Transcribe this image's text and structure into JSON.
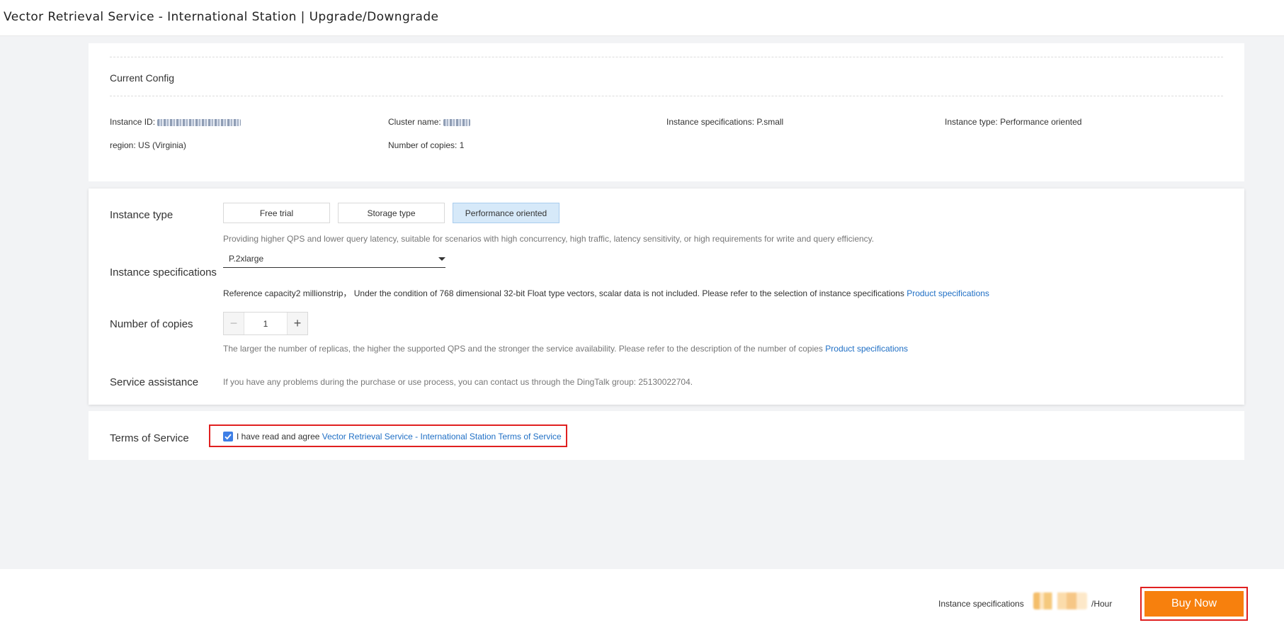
{
  "page": {
    "title": "Vector Retrieval Service - International Station | Upgrade/Downgrade"
  },
  "current_config": {
    "title": "Current Config",
    "instance_id_label": "Instance ID:",
    "cluster_name_label": "Cluster name:",
    "instance_spec_label": "Instance specifications:",
    "instance_spec_value": "P.small",
    "instance_type_label": "Instance type:",
    "instance_type_value": "Performance oriented",
    "region_label": "region:",
    "region_value": "US (Virginia)",
    "copies_label": "Number of copies:",
    "copies_value": "1"
  },
  "config": {
    "instance_type": {
      "label": "Instance type",
      "options": [
        "Free trial",
        "Storage type",
        "Performance oriented"
      ],
      "selected": "Performance oriented",
      "hint": "Providing higher QPS and lower query latency, suitable for scenarios with high concurrency, high traffic, latency sensitivity, or high requirements for write and query efficiency."
    },
    "instance_spec": {
      "label": "Instance specifications",
      "value": "P.2xlarge",
      "hint": "Reference capacity2 millionstrip， Under the condition of 768 dimensional 32-bit Float type vectors, scalar data is not included. Please refer to the selection of instance specifications",
      "link": "Product specifications"
    },
    "copies": {
      "label": "Number of copies",
      "minus": "−",
      "plus": "+",
      "value": "1",
      "hint": "The larger the number of replicas, the higher the supported QPS and the stronger the service availability. Please refer to the description of the number of copies",
      "link": "Product specifications"
    },
    "assistance": {
      "label": "Service assistance",
      "text": "If you have any problems during the purchase or use process, you can contact us through the DingTalk group: 25130022704."
    }
  },
  "terms": {
    "label": "Terms of Service",
    "checked": true,
    "agree_text": "I have read and agree",
    "link": "Vector Retrieval Service - International Station Terms of Service"
  },
  "footer": {
    "price_label": "Instance specifications",
    "price_unit": "/Hour",
    "buy_label": "Buy Now"
  },
  "colors": {
    "accent": "#f7800d",
    "link": "#1f6fc5",
    "checkbox": "#3e7fe6",
    "highlight": "#e02020",
    "selected_option": "#d6e9f9"
  },
  "icons": {
    "dropdown": "caret-down-icon",
    "check": "check-icon"
  }
}
